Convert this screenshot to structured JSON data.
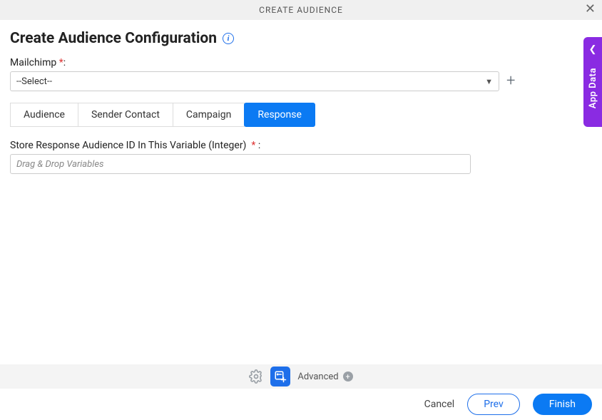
{
  "header": {
    "title": "CREATE AUDIENCE"
  },
  "page": {
    "title": "Create Audience Configuration"
  },
  "mailchimp": {
    "label": "Mailchimp",
    "value": "--Select--"
  },
  "tabs": [
    {
      "label": "Audience"
    },
    {
      "label": "Sender Contact"
    },
    {
      "label": "Campaign"
    },
    {
      "label": "Response"
    }
  ],
  "response": {
    "variable_label": "Store Response Audience ID In This Variable (Integer)",
    "placeholder": "Drag & Drop Variables"
  },
  "toolbar": {
    "advanced": "Advanced"
  },
  "footer": {
    "cancel": "Cancel",
    "prev": "Prev",
    "finish": "Finish"
  },
  "side": {
    "label": "App Data"
  }
}
